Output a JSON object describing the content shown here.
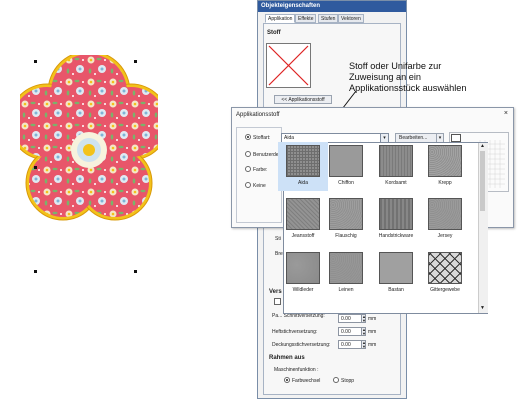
{
  "callout": {
    "line1": "Stoff oder Unifarbe zur",
    "line2": "Zuweisung an ein",
    "line3": "Applikationsstück auswählen"
  },
  "properties_panel": {
    "title": "Objekteigenschaften",
    "tabs": [
      "Applikation",
      "Effekte",
      "Stufen",
      "Vektoren"
    ],
    "stoff_heading": "Stoff",
    "stoff_button": "<< Applikationsstoff",
    "partial_labels": [
      "Sti",
      "Sti",
      "Bre"
    ],
    "vers_heading": "Vers",
    "fields": [
      {
        "label": "Pa... Schnittversetzung:",
        "value": "0.00",
        "unit": "mm"
      },
      {
        "label": "Heftstichversetzung:",
        "value": "0.00",
        "unit": "mm"
      },
      {
        "label": "Deckungsstichversetzung:",
        "value": "0.00",
        "unit": "mm"
      }
    ],
    "rahmen_heading": "Rahmen aus",
    "maschinen_label": "Maschinenfunktion :",
    "radio_farbwechsel": "Farbwechsel",
    "radio_stopp": "Stopp"
  },
  "dialog": {
    "title": "Applikationsstoff",
    "close": "×",
    "radio_stoffart": "Stoffart:",
    "radio_benutzerdef": "Benutzerdef",
    "radio_farbe": "Farbe:",
    "radio_keine": "Keine",
    "combo_value": "Aida",
    "edit_button": "Bearbeiten...",
    "dropdown_arrow": "▾",
    "fabrics": [
      {
        "name": "Aida",
        "color": "#8f8f8f",
        "pattern": "grid"
      },
      {
        "name": "Chiffon",
        "color": "#9a9a9a",
        "pattern": "plain"
      },
      {
        "name": "Kordsamt",
        "color": "#8c8c8c",
        "pattern": "stripes"
      },
      {
        "name": "Krepp",
        "color": "#a3a3a3",
        "pattern": "noise"
      },
      {
        "name": "Jeansstoff",
        "color": "#939393",
        "pattern": "diag"
      },
      {
        "name": "Flauschig",
        "color": "#9e9e9e",
        "pattern": "noise"
      },
      {
        "name": "Handstrickware",
        "color": "#878787",
        "pattern": "knit"
      },
      {
        "name": "Jersey",
        "color": "#9b9b9b",
        "pattern": "noise"
      },
      {
        "name": "Wildleder",
        "color": "#8a8a8a",
        "pattern": "suede"
      },
      {
        "name": "Leinen",
        "color": "#979797",
        "pattern": "noise"
      },
      {
        "name": "Bastan",
        "color": "#a0a0a0",
        "pattern": "plain"
      },
      {
        "name": "Gittergewebe",
        "color": "#d8d8d8",
        "pattern": "lattice"
      }
    ]
  },
  "colors": {
    "flower_fill": "#e8566a",
    "flower_border": "#f3c21a",
    "title_bar": "#2f5a9e",
    "selection": "#cde1f7"
  }
}
